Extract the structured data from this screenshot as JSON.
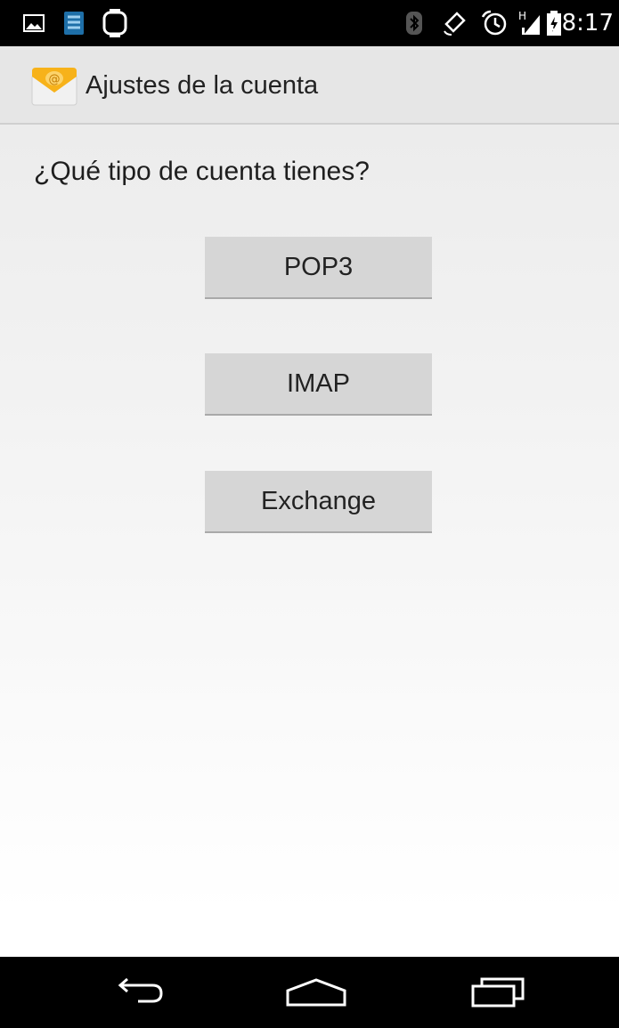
{
  "status_bar": {
    "time": "08:17",
    "left_icons": [
      "gallery-icon",
      "app-notification-icon",
      "sync-icon"
    ],
    "right_icons": [
      "bluetooth-icon",
      "rotation-icon",
      "alarm-icon",
      "signal-icon",
      "battery-icon"
    ],
    "network_type": "H"
  },
  "action_bar": {
    "title": "Ajustes de la cuenta",
    "icon": "email-app-icon"
  },
  "main": {
    "question": "¿Qué tipo de cuenta tienes?",
    "buttons": [
      {
        "label": "POP3"
      },
      {
        "label": "IMAP"
      },
      {
        "label": "Exchange"
      }
    ]
  },
  "nav_bar": {
    "icons": [
      "back-icon",
      "home-icon",
      "recent-apps-icon"
    ]
  },
  "colors": {
    "status_bar": "#000000",
    "action_bar": "#e6e6e6",
    "button": "#d6d6d6",
    "text": "#222222"
  }
}
